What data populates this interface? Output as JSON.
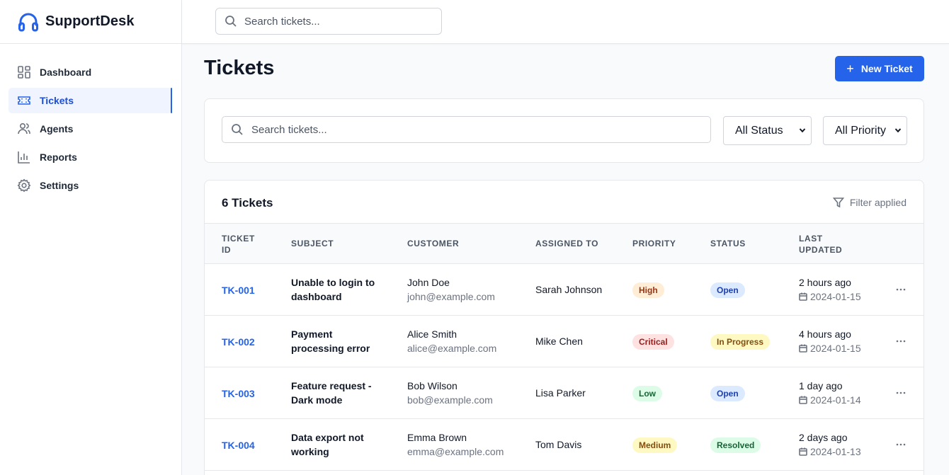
{
  "app": {
    "name": "SupportDesk",
    "brand_color": "#2563eb"
  },
  "sidebar": {
    "items": [
      {
        "label": "Dashboard",
        "icon": "dashboard-icon",
        "active": false
      },
      {
        "label": "Tickets",
        "icon": "ticket-icon",
        "active": true
      },
      {
        "label": "Agents",
        "icon": "users-icon",
        "active": false
      },
      {
        "label": "Reports",
        "icon": "bar-chart-icon",
        "active": false
      },
      {
        "label": "Settings",
        "icon": "gear-icon",
        "active": false
      }
    ]
  },
  "topbar": {
    "search_placeholder": "Search tickets..."
  },
  "page": {
    "title": "Tickets",
    "new_button_label": "New Ticket"
  },
  "filters": {
    "search_placeholder": "Search tickets...",
    "status_selected": "All Status",
    "priority_selected": "All Priority"
  },
  "table": {
    "count_label": "6 Tickets",
    "filter_label": "Filter applied",
    "headers": [
      "Ticket ID",
      "Subject",
      "Customer",
      "Assigned To",
      "Priority",
      "Status",
      "Last Updated"
    ],
    "rows": [
      {
        "id": "TK-001",
        "subject": "Unable to login to dashboard",
        "customer_name": "John Doe",
        "customer_email": "john@example.com",
        "assigned_to": "Sarah Johnson",
        "priority": "High",
        "status": "Open",
        "updated_relative": "2 hours ago",
        "updated_date": "2024-01-15"
      },
      {
        "id": "TK-002",
        "subject": "Payment processing error",
        "customer_name": "Alice Smith",
        "customer_email": "alice@example.com",
        "assigned_to": "Mike Chen",
        "priority": "Critical",
        "status": "In Progress",
        "updated_relative": "4 hours ago",
        "updated_date": "2024-01-15"
      },
      {
        "id": "TK-003",
        "subject": "Feature request - Dark mode",
        "customer_name": "Bob Wilson",
        "customer_email": "bob@example.com",
        "assigned_to": "Lisa Parker",
        "priority": "Low",
        "status": "Open",
        "updated_relative": "1 day ago",
        "updated_date": "2024-01-14"
      },
      {
        "id": "TK-004",
        "subject": "Data export not working",
        "customer_name": "Emma Brown",
        "customer_email": "emma@example.com",
        "assigned_to": "Tom Davis",
        "priority": "Medium",
        "status": "Resolved",
        "updated_relative": "2 days ago",
        "updated_date": "2024-01-13"
      }
    ]
  }
}
